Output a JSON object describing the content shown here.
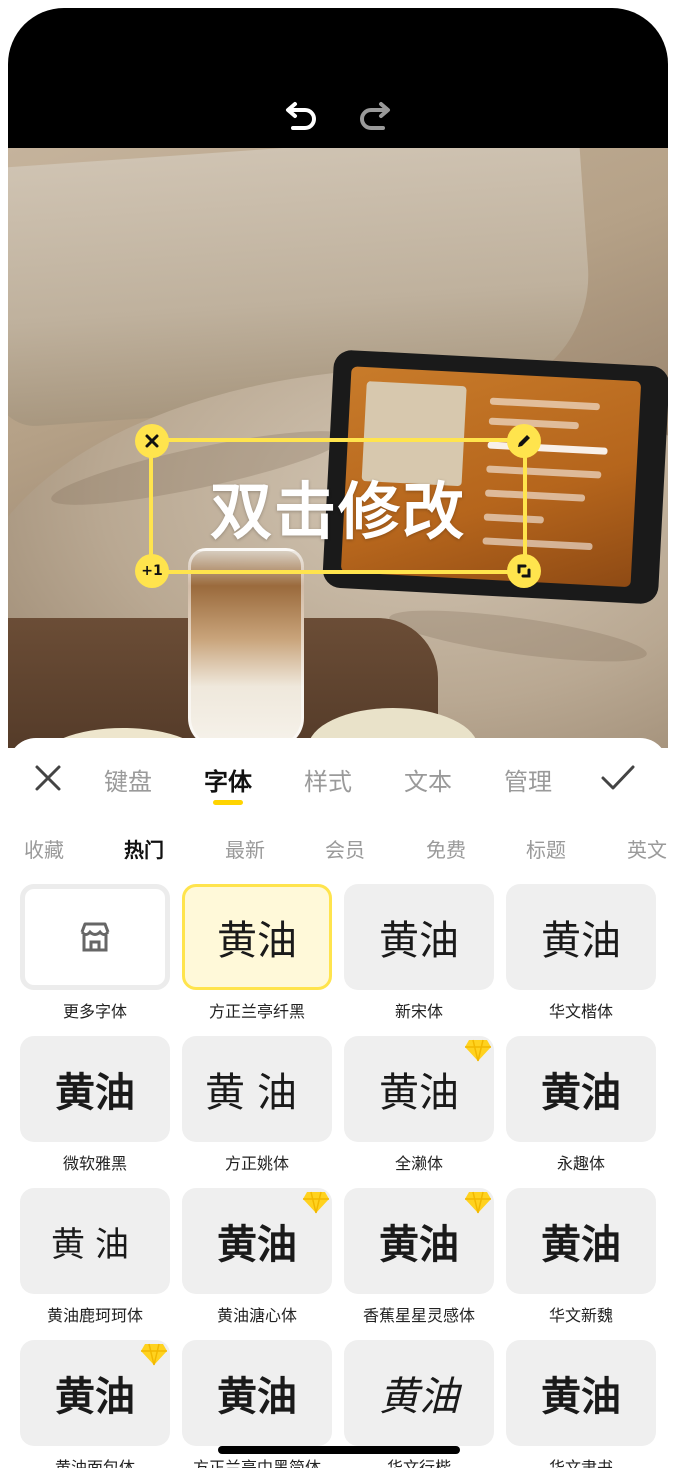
{
  "canvas": {
    "textbox": {
      "label": "双击修改",
      "copy_label": "+1"
    }
  },
  "panel": {
    "tabs": [
      {
        "label": "键盘"
      },
      {
        "label": "字体"
      },
      {
        "label": "样式"
      },
      {
        "label": "文本"
      },
      {
        "label": "管理"
      }
    ],
    "active_tab": "字体",
    "categories": [
      {
        "label": "收藏"
      },
      {
        "label": "热门"
      },
      {
        "label": "最新"
      },
      {
        "label": "会员"
      },
      {
        "label": "免费"
      },
      {
        "label": "标题"
      },
      {
        "label": "英文"
      }
    ],
    "active_category": "热门",
    "preview_text": "黄油",
    "fonts": [
      {
        "name": "更多字体",
        "icon": "store-icon"
      },
      {
        "name": "方正兰亭纤黑",
        "selected": true
      },
      {
        "name": "新宋体"
      },
      {
        "name": "华文楷体"
      },
      {
        "name": "微软雅黑"
      },
      {
        "name": "方正姚体"
      },
      {
        "name": "全濑体",
        "vip": true
      },
      {
        "name": "永趣体"
      },
      {
        "name": "黄油鹿珂珂体"
      },
      {
        "name": "黄油溏心体",
        "vip": true
      },
      {
        "name": "香蕉星星灵感体",
        "vip": true
      },
      {
        "name": "华文新魏"
      },
      {
        "name": "黄油面包体",
        "vip": true
      },
      {
        "name": "方正兰亭中黑简体"
      },
      {
        "name": "华文行楷"
      },
      {
        "name": "华文隶书"
      }
    ]
  },
  "colors": {
    "accent": "#ffe44d",
    "underline": "#ffd400",
    "vip_gem": "#ffd21f"
  }
}
